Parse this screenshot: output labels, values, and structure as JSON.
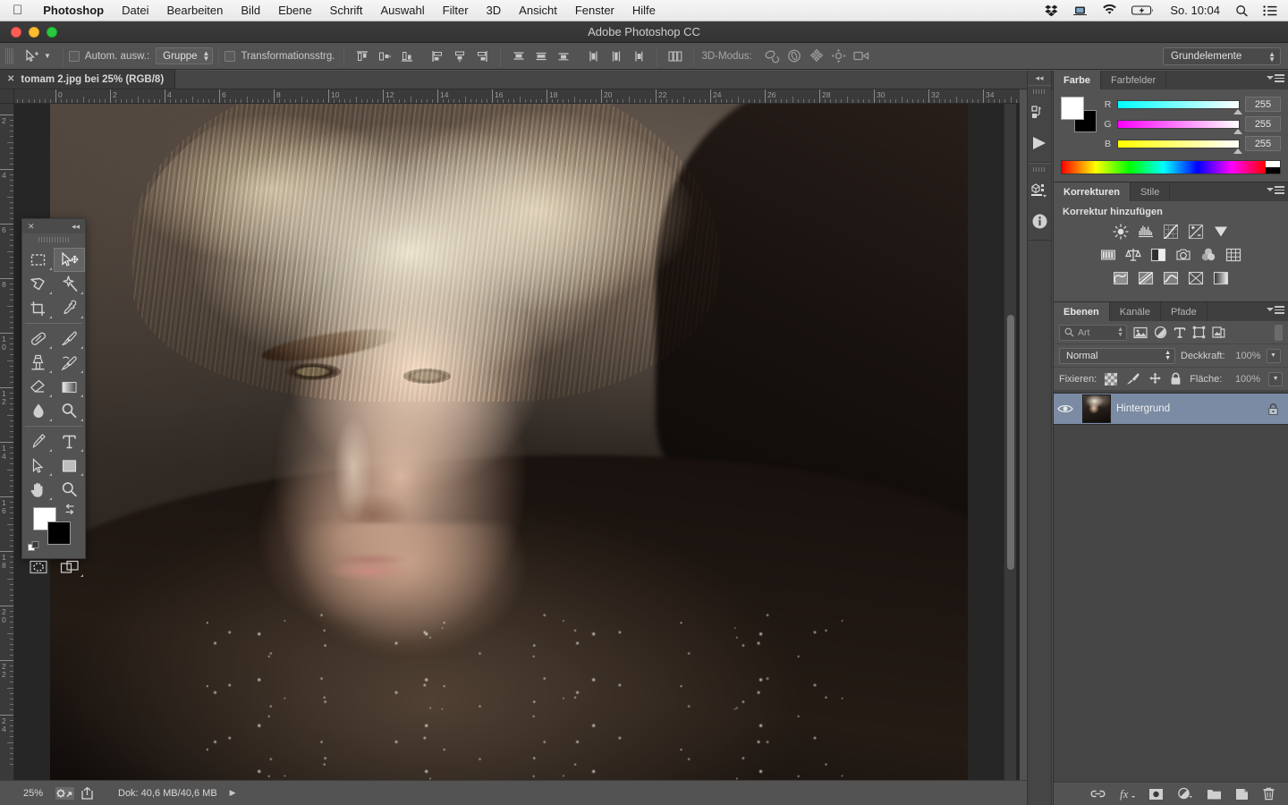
{
  "menubar": {
    "apple_icon": "apple-icon",
    "app_name": "Photoshop",
    "items": [
      "Datei",
      "Bearbeiten",
      "Bild",
      "Ebene",
      "Schrift",
      "Auswahl",
      "Filter",
      "3D",
      "Ansicht",
      "Fenster",
      "Hilfe"
    ],
    "status_icons": [
      "dropbox-icon",
      "screen-share-icon",
      "wifi-icon",
      "battery-icon"
    ],
    "clock": "So. 10:04",
    "search_icon": "search-icon",
    "control_center_icon": "control-center-icon"
  },
  "window": {
    "title": "Adobe Photoshop CC",
    "close_label": "",
    "minimize_label": "",
    "zoom_label": ""
  },
  "options_bar": {
    "tool_icon": "move-tool-icon",
    "auto_select_label": "Autom. ausw.:",
    "auto_select_value": "Gruppe",
    "transform_controls_label": "Transformationsstrg.",
    "align_icons": [
      "align-top-edges-icon",
      "align-vertical-centers-icon",
      "align-bottom-edges-icon",
      "align-left-edges-icon",
      "align-horizontal-centers-icon",
      "align-right-edges-icon"
    ],
    "distribute_icons": [
      "distribute-top-edges-icon",
      "distribute-vertical-centers-icon",
      "distribute-bottom-edges-icon",
      "distribute-left-edges-icon",
      "distribute-horizontal-centers-icon",
      "distribute-right-edges-icon"
    ],
    "more_align_icon": "align-options-icon",
    "mode_3d_label": "3D-Modus:",
    "mode_3d_icons": [
      "rotate-3d-icon",
      "roll-3d-icon",
      "drag-3d-icon",
      "slide-3d-icon",
      "scale-3d-icon"
    ],
    "workspace": "Grundelemente"
  },
  "document": {
    "tab_title": "tomam 2.jpg bei 25% (RGB/8)",
    "close_icon": "close-icon"
  },
  "rulers": {
    "horizontal_labels": [
      "0",
      "2",
      "4",
      "6",
      "8",
      "10",
      "12",
      "14",
      "16",
      "18",
      "20",
      "22",
      "24",
      "26",
      "28",
      "30",
      "32",
      "34"
    ],
    "vertical_labels": [
      "2",
      "4",
      "6",
      "8",
      "10",
      "12",
      "14",
      "16",
      "18",
      "20",
      "22",
      "24"
    ],
    "unit": "cm"
  },
  "status_bar": {
    "zoom": "25%",
    "icons": [
      "preferences-icon",
      "share-icon"
    ],
    "doc_size": "Dok: 40,6 MB/40,6 MB",
    "expand_icon": "play-triangle-icon"
  },
  "tools_panel": {
    "close_icon": "close-icon",
    "collapse_icon": "collapse-icon",
    "tools": [
      {
        "name": "rectangular-marquee-tool-icon",
        "active": false
      },
      {
        "name": "move-tool-icon",
        "active": true
      },
      {
        "name": "lasso-tool-icon",
        "active": false
      },
      {
        "name": "magic-wand-tool-icon",
        "active": false
      },
      {
        "name": "crop-tool-icon",
        "active": false
      },
      {
        "name": "eyedropper-tool-icon",
        "active": false
      },
      {
        "name": "healing-brush-tool-icon",
        "active": false
      },
      {
        "name": "brush-tool-icon",
        "active": false
      },
      {
        "name": "clone-stamp-tool-icon",
        "active": false
      },
      {
        "name": "history-brush-tool-icon",
        "active": false
      },
      {
        "name": "eraser-tool-icon",
        "active": false
      },
      {
        "name": "gradient-tool-icon",
        "active": false
      },
      {
        "name": "blur-tool-icon",
        "active": false
      },
      {
        "name": "dodge-tool-icon",
        "active": false
      },
      {
        "name": "pen-tool-icon",
        "active": false
      },
      {
        "name": "type-tool-icon",
        "active": false
      },
      {
        "name": "path-selection-tool-icon",
        "active": false
      },
      {
        "name": "rectangle-tool-icon",
        "active": false
      },
      {
        "name": "hand-tool-icon",
        "active": false
      },
      {
        "name": "zoom-tool-icon",
        "active": false
      }
    ],
    "foreground_color": "#ffffff",
    "background_color": "#000000",
    "swap_icon": "swap-colors-icon",
    "default_icon": "default-colors-icon",
    "quick_mask_icon": "quick-mask-icon",
    "screen_mode_icon": "screen-mode-icon"
  },
  "icon_dock": {
    "expand_icon": "expand-panels-icon",
    "buttons": [
      "history-icon",
      "actions-play-icon",
      "3d-properties-icon",
      "info-icon"
    ]
  },
  "color_panel": {
    "tabs": [
      {
        "label": "Farbe",
        "active": true
      },
      {
        "label": "Farbfelder",
        "active": false
      }
    ],
    "menu_icon": "panel-menu-icon",
    "foreground_color": "#ffffff",
    "background_color": "#000000",
    "channels": [
      {
        "label": "R",
        "value": "255",
        "gradient_from": "#00ffff",
        "gradient_to": "#ffffff"
      },
      {
        "label": "G",
        "value": "255",
        "gradient_from": "#ff00ff",
        "gradient_to": "#ffffff"
      },
      {
        "label": "B",
        "value": "255",
        "gradient_from": "#ffff00",
        "gradient_to": "#ffffff"
      }
    ]
  },
  "adjustments_panel": {
    "tabs": [
      {
        "label": "Korrekturen",
        "active": true
      },
      {
        "label": "Stile",
        "active": false
      }
    ],
    "menu_icon": "panel-menu-icon",
    "title": "Korrektur hinzufügen",
    "row1": [
      "brightness-contrast-icon",
      "levels-icon",
      "curves-icon",
      "exposure-icon",
      "vibrance-icon"
    ],
    "row2": [
      "hue-saturation-icon",
      "color-balance-icon",
      "black-white-icon",
      "photo-filter-icon",
      "channel-mixer-icon",
      "color-lookup-icon"
    ],
    "row3": [
      "invert-icon",
      "posterize-icon",
      "threshold-icon",
      "selective-color-icon",
      "gradient-map-icon"
    ]
  },
  "layers_panel": {
    "tabs": [
      {
        "label": "Ebenen",
        "active": true
      },
      {
        "label": "Kanäle",
        "active": false
      },
      {
        "label": "Pfade",
        "active": false
      }
    ],
    "menu_icon": "panel-menu-icon",
    "filter_icon": "search-icon",
    "filter_value": "Art",
    "filter_type_icons": [
      "filter-pixel-icon",
      "filter-adjustment-icon",
      "filter-type-icon",
      "filter-shape-icon",
      "filter-smart-object-icon"
    ],
    "filter_toggle_icon": "filter-enable-toggle",
    "blend_mode": "Normal",
    "opacity_label": "Deckkraft:",
    "opacity_value": "100%",
    "lock_label": "Fixieren:",
    "lock_icons": [
      "lock-transparency-icon",
      "lock-image-icon",
      "lock-position-icon",
      "lock-all-icon"
    ],
    "fill_label": "Fläche:",
    "fill_value": "100%",
    "layers": [
      {
        "name": "Hintergrund",
        "visible": true,
        "locked": true,
        "selected": true,
        "visibility_icon": "eye-icon",
        "lock_icon": "lock-icon"
      }
    ],
    "bottom_icons": [
      "link-layers-icon",
      "layer-style-fx-icon",
      "add-layer-mask-icon",
      "new-adjustment-layer-icon",
      "new-group-icon",
      "new-layer-icon",
      "delete-layer-icon"
    ]
  },
  "colors": {
    "panel_bg": "#535353",
    "panel_dark": "#454545",
    "canvas_bg": "#262626",
    "selection_blue": "#7a8ba3",
    "text": "#d4d4d4"
  }
}
